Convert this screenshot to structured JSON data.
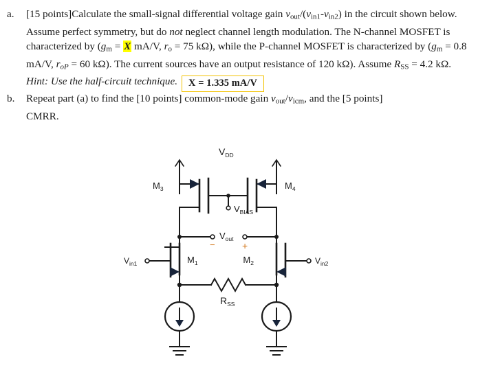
{
  "document": {
    "type": "problem-statement",
    "items": [
      {
        "marker": "a.",
        "points_label": "[15 points]",
        "text_1": "Calculate the small-signal differential voltage gain ",
        "gain_expr_v1": "v",
        "gain_expr_sub1": "out",
        "gain_expr_slash": "/(",
        "gain_expr_v2": "v",
        "gain_expr_sub2": "in1",
        "gain_expr_dash": "-",
        "gain_expr_v3": "v",
        "gain_expr_sub3": "in2",
        "gain_expr_close": ") in the",
        "text_2": "circuit shown below. Assume perfect symmetry, but do ",
        "text_2_em": "not",
        "text_2b": " neglect channel length",
        "text_3a": "modulation. The N-channel MOSFET is characterized by (",
        "gm_g": "g",
        "gm_sub": "m",
        "gm_eq": " = ",
        "x_value": "X",
        "gm_units": " mA/V, ",
        "ro_r": "r",
        "ro_sub": "o",
        "ro_eq": " = 75 kΩ),",
        "text_4a": "while the P-channel MOSFET is characterized by (",
        "gm2_g": "g",
        "gm2_sub": "m",
        "gm2_val": " = 0.8 mA/V, ",
        "rop_r": "r",
        "rop_sub": "oP",
        "rop_val": " = 60 kΩ). The",
        "text_5a": "current sources have an output resistance of 120 kΩ). Assume ",
        "rss_r": "R",
        "rss_sub": "SS",
        "rss_val": " = 4.2 kΩ.",
        "hint": "Hint: Use the half-circuit technique.",
        "answer": "X = 1.335 mA/V"
      },
      {
        "marker": "b.",
        "text_1": "Repeat part (a) to find the ",
        "points_label": "[10 points]",
        "text_2": " common-mode gain ",
        "cm_v1": "v",
        "cm_sub1": "out",
        "cm_slash": "/",
        "cm_v2": "v",
        "cm_sub2": "icm",
        "text_3": ", and the ",
        "points_label_2": "[5 points]",
        "text_4": "CMRR."
      }
    ]
  },
  "answer_box": {
    "value": "X = 1.335 mA/V",
    "border_color": "#f2c200",
    "background_color": "#ffffff"
  },
  "highlight": {
    "value": "X",
    "color": "#ffff00"
  },
  "circuit": {
    "title": "MOSFET differential amplifier with active PMOS loads",
    "labels": {
      "vdd": "V",
      "vdd_sub": "DD",
      "m3": "M",
      "m3_sub": "3",
      "m4": "M",
      "m4_sub": "4",
      "vbias": "V",
      "vbias_sub": "BIAS",
      "vout": "V",
      "vout_sub": "out",
      "minus": "−",
      "plus": "+",
      "m1": "M",
      "m1_sub": "1",
      "m2": "M",
      "m2_sub": "2",
      "vin1": "V",
      "vin1_sub": "in1",
      "vin2": "V",
      "vin2_sub": "in2",
      "rss": "R",
      "rss_sub": "SS"
    },
    "colors": {
      "wire": "#1a1a1a",
      "arrow": "#18243a",
      "sign": "#d2761b"
    },
    "components": [
      {
        "name": "M3",
        "type": "pmos"
      },
      {
        "name": "M4",
        "type": "pmos"
      },
      {
        "name": "M1",
        "type": "nmos"
      },
      {
        "name": "M2",
        "type": "nmos"
      },
      {
        "name": "RSS",
        "type": "resistor"
      },
      {
        "name": "I1",
        "type": "current-source"
      },
      {
        "name": "I2",
        "type": "current-source"
      },
      {
        "name": "GND1",
        "type": "ground"
      },
      {
        "name": "GND2",
        "type": "ground"
      }
    ]
  }
}
